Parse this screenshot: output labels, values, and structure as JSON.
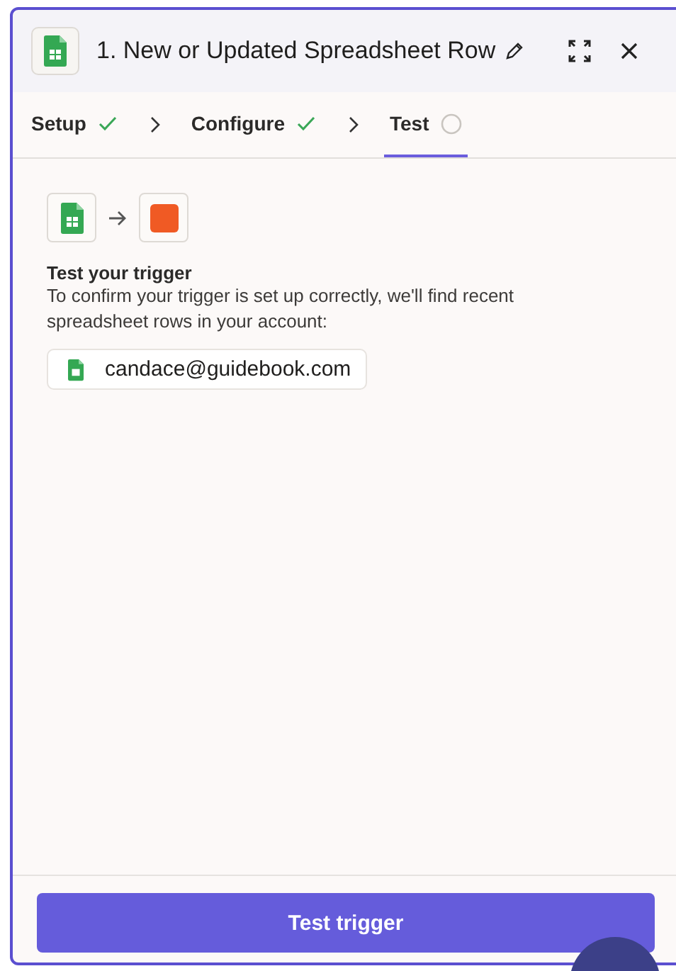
{
  "header": {
    "title": "1. New or Updated Spreadsheet Row"
  },
  "steps": [
    {
      "label": "Setup",
      "done": true,
      "selected": false
    },
    {
      "label": "Configure",
      "done": true,
      "selected": false
    },
    {
      "label": "Test",
      "done": false,
      "selected": true
    }
  ],
  "content": {
    "heading": "Test your trigger",
    "description": "To confirm your trigger is set up correctly, we'll find recent spreadsheet rows in your account:",
    "account": "candace@guidebook.com"
  },
  "footer": {
    "button": "Test trigger"
  }
}
